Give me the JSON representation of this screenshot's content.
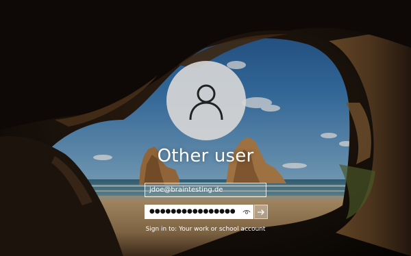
{
  "login": {
    "username": "Other user",
    "email_value": "jdoe@braintesting.de",
    "password_masked": "●●●●●●●●●●●●●●●●",
    "sign_in_prefix": "Sign in to: ",
    "sign_in_target": "Your work or school account"
  },
  "icons": {
    "avatar": "user-silhouette-icon",
    "reveal": "eye-icon",
    "submit": "arrow-right-icon"
  },
  "colors": {
    "sky": "#2f6ea6",
    "sand": "#b08a5a",
    "cave": "#1a120c",
    "avatar_bg": "#d6d6d6"
  }
}
